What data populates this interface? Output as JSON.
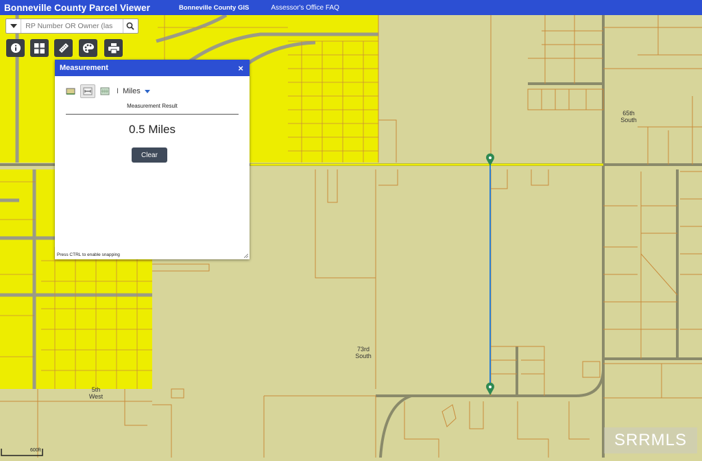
{
  "header": {
    "title": "Bonneville County Parcel Viewer",
    "links": [
      "Bonneville County GIS",
      "Assessor's Office FAQ"
    ]
  },
  "search": {
    "placeholder": "RP Number OR Owner (las"
  },
  "toolbar": {
    "tools": [
      "info-icon",
      "grid-icon",
      "ruler-icon",
      "palette-icon",
      "print-icon"
    ]
  },
  "measurement": {
    "title": "Measurement",
    "close": "×",
    "unit_sep": "I",
    "unit": "Miles",
    "result_label": "Measurement Result",
    "result_value": "0.5 Miles",
    "clear_label": "Clear",
    "snap_hint": "Press CTRL to enable snapping"
  },
  "map": {
    "labels": [
      {
        "id": "65th",
        "lines": [
          "65th",
          "South"
        ]
      },
      {
        "id": "73rd",
        "lines": [
          "73rd",
          "South"
        ]
      },
      {
        "id": "5th",
        "lines": [
          "5th",
          "West"
        ]
      }
    ],
    "scale": "600ft",
    "watermark": "SRRMLS",
    "colors": {
      "parcel_fill": "#d7d59a",
      "highlight": "#eded00",
      "parcel_line": "#c98a3a",
      "measure_line": "#2a7fd4",
      "pin": "#2f8a52"
    }
  }
}
